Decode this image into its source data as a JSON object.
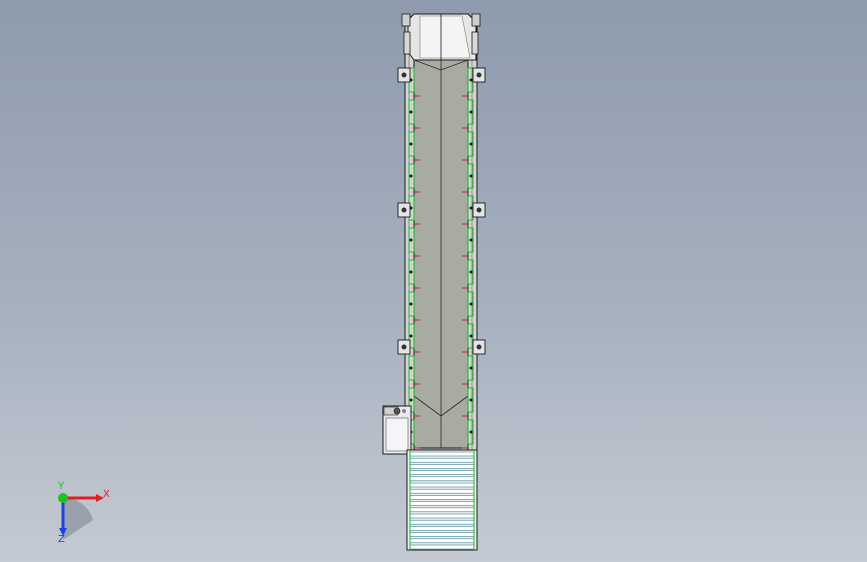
{
  "viewport": {
    "background_top": "#8e9bad",
    "background_bottom": "#c4cad3",
    "edge_color": "#1a1a1a",
    "highlight_color": "#10c020",
    "belt_color": "#a8aba0",
    "frame_color": "#d8d8d8"
  },
  "model": {
    "name": "inclined-belt-conveyor",
    "mounting_brackets": 6,
    "roller_rows": 16
  },
  "triad": {
    "x_label": "X",
    "y_label": "Y",
    "z_label": "Z",
    "x_color": "#e02020",
    "y_color": "#20c020",
    "z_color": "#2040e0"
  }
}
